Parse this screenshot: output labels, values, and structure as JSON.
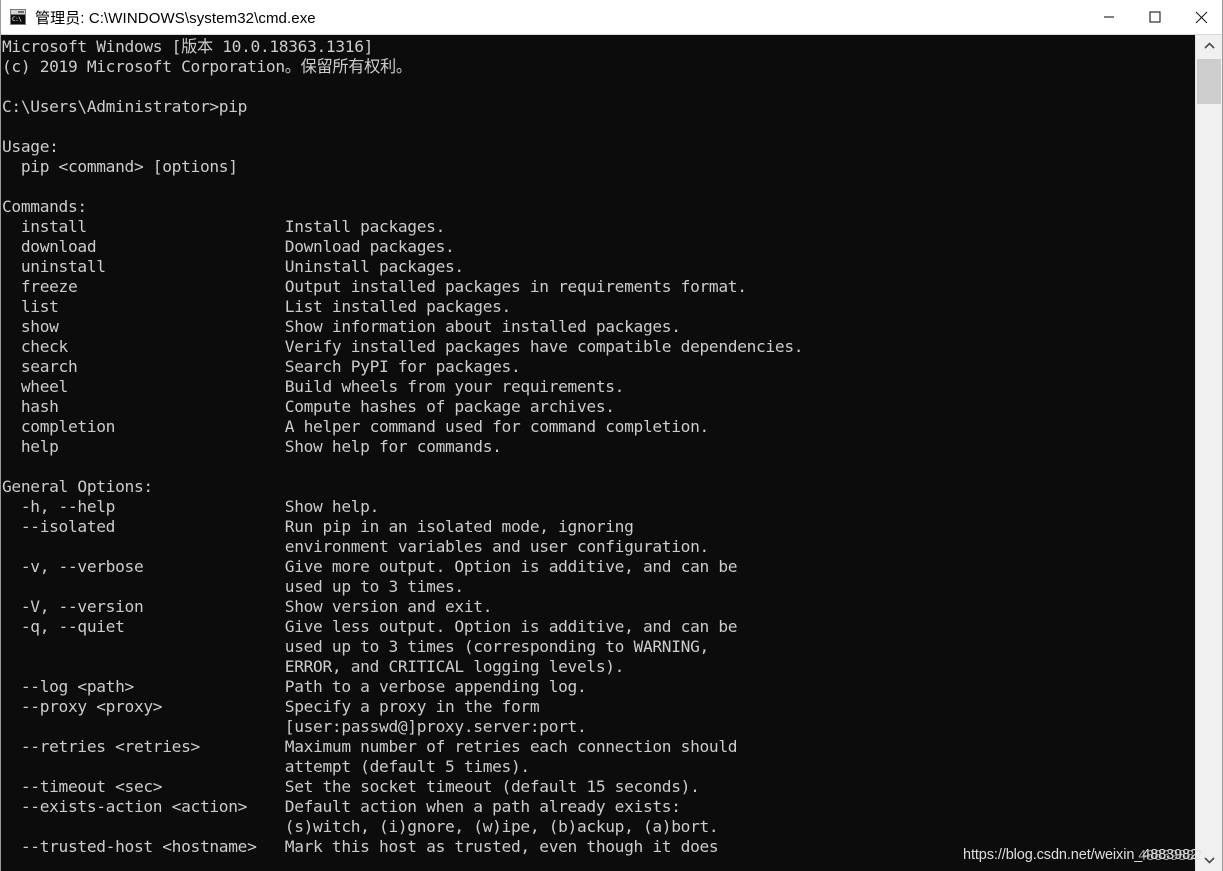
{
  "window": {
    "title": "管理员: C:\\WINDOWS\\system32\\cmd.exe",
    "icon_label": "C:\\",
    "background_color": "#0c0c0c",
    "text_color": "#cccccc",
    "titlebar_color": "#ffffff"
  },
  "controls": {
    "minimize_label": "最小化",
    "maximize_label": "最大化",
    "close_label": "关闭"
  },
  "scrollbar": {
    "up_label": "向上滚动",
    "down_label": "向下滚动",
    "thumb_label": "滚动条滑块"
  },
  "watermark": {
    "text": "https://blog.csdn.net/weixin_4883982",
    "overlay": "48839882"
  },
  "terminal": {
    "lines": [
      "Microsoft Windows [版本 10.0.18363.1316]",
      "(c) 2019 Microsoft Corporation。保留所有权利。",
      "",
      "C:\\Users\\Administrator>pip",
      "",
      "Usage:",
      "  pip <command> [options]",
      "",
      "Commands:",
      "  install                     Install packages.",
      "  download                    Download packages.",
      "  uninstall                   Uninstall packages.",
      "  freeze                      Output installed packages in requirements format.",
      "  list                        List installed packages.",
      "  show                        Show information about installed packages.",
      "  check                       Verify installed packages have compatible dependencies.",
      "  search                      Search PyPI for packages.",
      "  wheel                       Build wheels from your requirements.",
      "  hash                        Compute hashes of package archives.",
      "  completion                  A helper command used for command completion.",
      "  help                        Show help for commands.",
      "",
      "General Options:",
      "  -h, --help                  Show help.",
      "  --isolated                  Run pip in an isolated mode, ignoring",
      "                              environment variables and user configuration.",
      "  -v, --verbose               Give more output. Option is additive, and can be",
      "                              used up to 3 times.",
      "  -V, --version               Show version and exit.",
      "  -q, --quiet                 Give less output. Option is additive, and can be",
      "                              used up to 3 times (corresponding to WARNING,",
      "                              ERROR, and CRITICAL logging levels).",
      "  --log <path>                Path to a verbose appending log.",
      "  --proxy <proxy>             Specify a proxy in the form",
      "                              [user:passwd@]proxy.server:port.",
      "  --retries <retries>         Maximum number of retries each connection should",
      "                              attempt (default 5 times).",
      "  --timeout <sec>             Set the socket timeout (default 15 seconds).",
      "  --exists-action <action>    Default action when a path already exists:",
      "                              (s)witch, (i)gnore, (w)ipe, (b)ackup, (a)bort.",
      "  --trusted-host <hostname>   Mark this host as trusted, even though it does"
    ],
    "command_entered": "pip",
    "prompt": "C:\\Users\\Administrator>",
    "commands": [
      {
        "name": "install",
        "description": "Install packages."
      },
      {
        "name": "download",
        "description": "Download packages."
      },
      {
        "name": "uninstall",
        "description": "Uninstall packages."
      },
      {
        "name": "freeze",
        "description": "Output installed packages in requirements format."
      },
      {
        "name": "list",
        "description": "List installed packages."
      },
      {
        "name": "show",
        "description": "Show information about installed packages."
      },
      {
        "name": "check",
        "description": "Verify installed packages have compatible dependencies."
      },
      {
        "name": "search",
        "description": "Search PyPI for packages."
      },
      {
        "name": "wheel",
        "description": "Build wheels from your requirements."
      },
      {
        "name": "hash",
        "description": "Compute hashes of package archives."
      },
      {
        "name": "completion",
        "description": "A helper command used for command completion."
      },
      {
        "name": "help",
        "description": "Show help for commands."
      }
    ],
    "general_options": [
      {
        "flag": "-h, --help",
        "description": "Show help."
      },
      {
        "flag": "--isolated",
        "description": "Run pip in an isolated mode, ignoring environment variables and user configuration."
      },
      {
        "flag": "-v, --verbose",
        "description": "Give more output. Option is additive, and can be used up to 3 times."
      },
      {
        "flag": "-V, --version",
        "description": "Show version and exit."
      },
      {
        "flag": "-q, --quiet",
        "description": "Give less output. Option is additive, and can be used up to 3 times (corresponding to WARNING, ERROR, and CRITICAL logging levels)."
      },
      {
        "flag": "--log <path>",
        "description": "Path to a verbose appending log."
      },
      {
        "flag": "--proxy <proxy>",
        "description": "Specify a proxy in the form [user:passwd@]proxy.server:port."
      },
      {
        "flag": "--retries <retries>",
        "description": "Maximum number of retries each connection should attempt (default 5 times)."
      },
      {
        "flag": "--timeout <sec>",
        "description": "Set the socket timeout (default 15 seconds)."
      },
      {
        "flag": "--exists-action <action>",
        "description": "Default action when a path already exists: (s)witch, (i)gnore, (w)ipe, (b)ackup, (a)bort."
      },
      {
        "flag": "--trusted-host <hostname>",
        "description": "Mark this host as trusted, even though it does"
      }
    ],
    "headers": {
      "usage": "Usage:",
      "usage_line": "  pip <command> [options]",
      "commands": "Commands:",
      "general_options": "General Options:"
    },
    "banner": {
      "line1": "Microsoft Windows [版本 10.0.18363.1316]",
      "line2": "(c) 2019 Microsoft Corporation。保留所有权利。"
    }
  }
}
